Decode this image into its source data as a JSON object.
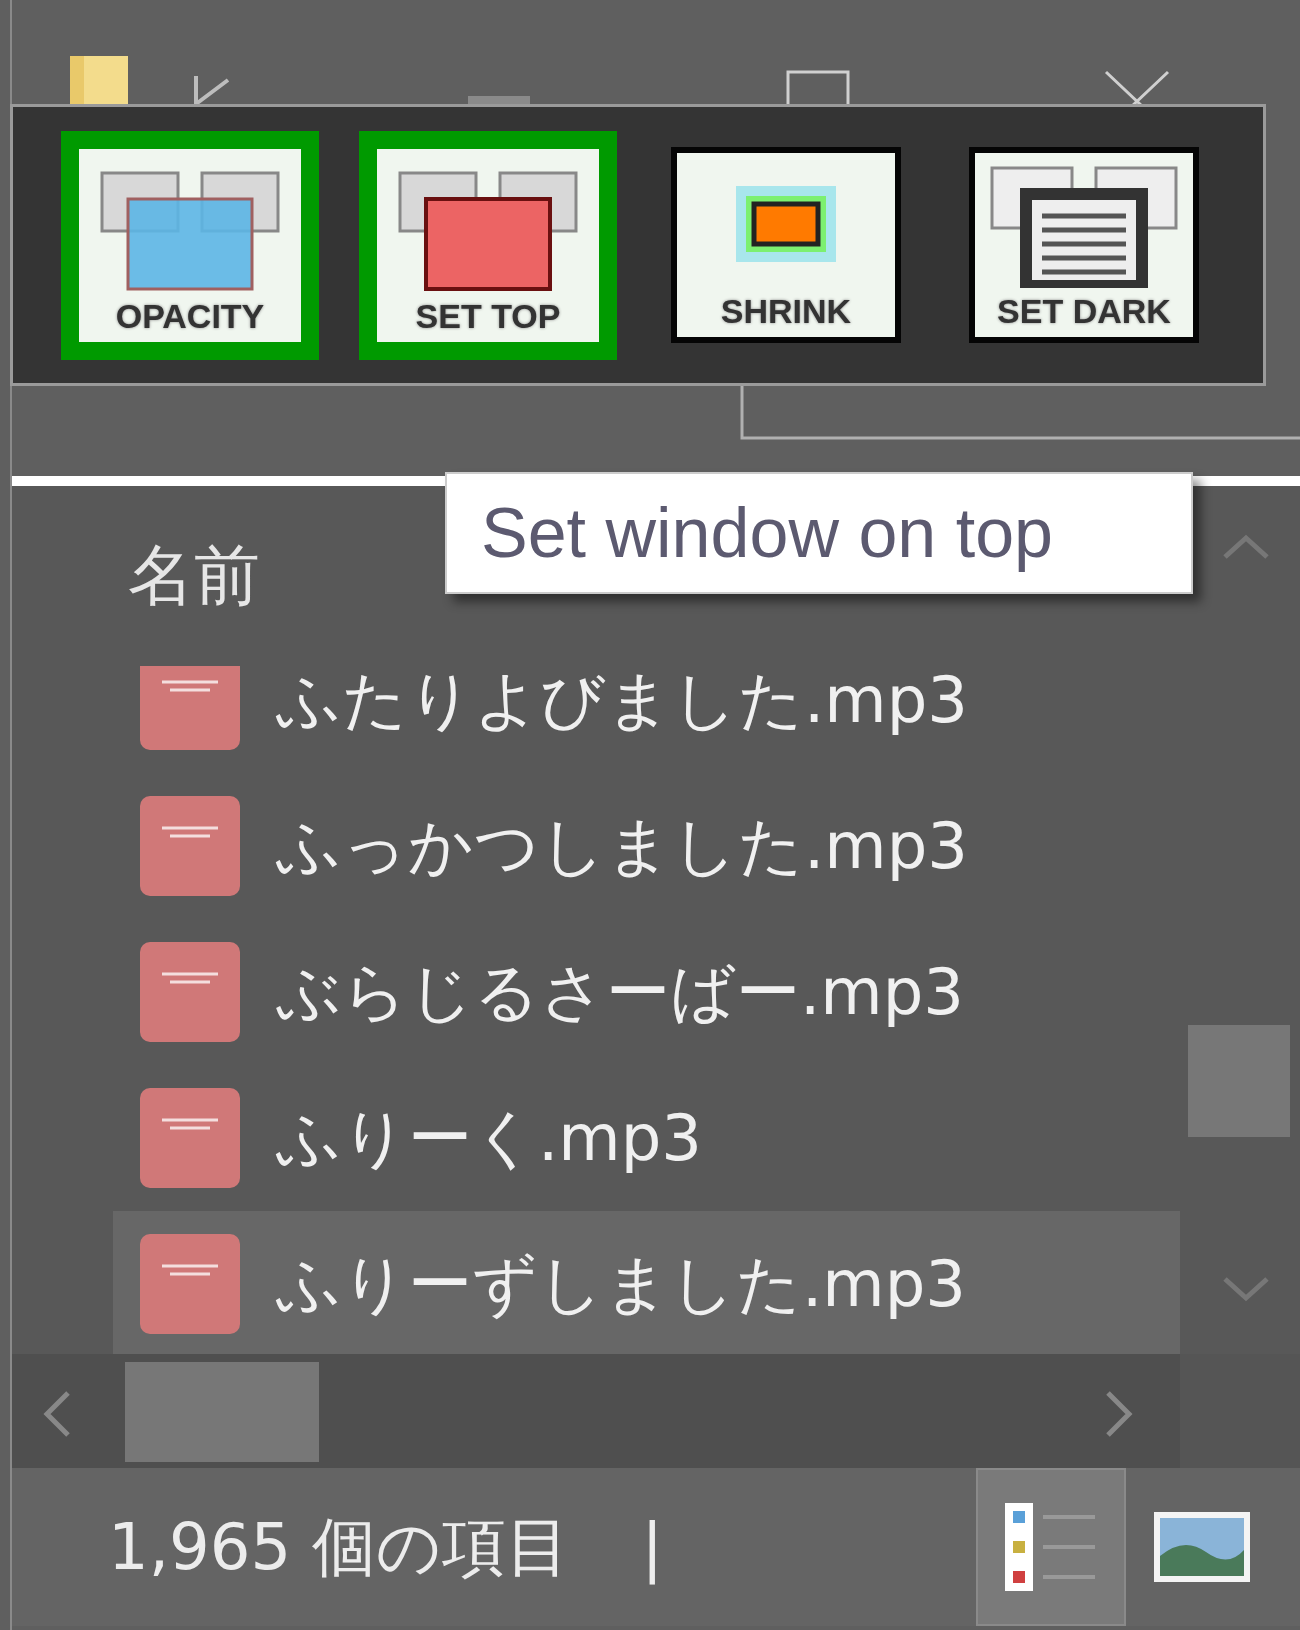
{
  "toolbar": {
    "buttons": [
      {
        "label": "OPACITY",
        "kind": "opacity",
        "selected": true
      },
      {
        "label": "SET TOP",
        "kind": "top",
        "selected": true
      },
      {
        "label": "SHRINK",
        "kind": "shrink",
        "selected": false
      },
      {
        "label": "SET DARK",
        "kind": "dark",
        "selected": false
      }
    ]
  },
  "tooltip": "Set window on top",
  "file_list": {
    "column_header": "名前",
    "files": [
      {
        "name": "ふたりよびました.mp3",
        "selected": false
      },
      {
        "name": "ふっかつしました.mp3",
        "selected": false
      },
      {
        "name": "ぶらじるさーばー.mp3",
        "selected": false
      },
      {
        "name": "ふりーく.mp3",
        "selected": false
      },
      {
        "name": "ふりーずしました.mp3",
        "selected": true
      }
    ]
  },
  "status_bar": {
    "item_count": "1,965 個の項目",
    "separator": "|",
    "views": [
      {
        "kind": "details",
        "selected": true
      },
      {
        "kind": "large-icons",
        "selected": false
      }
    ]
  }
}
